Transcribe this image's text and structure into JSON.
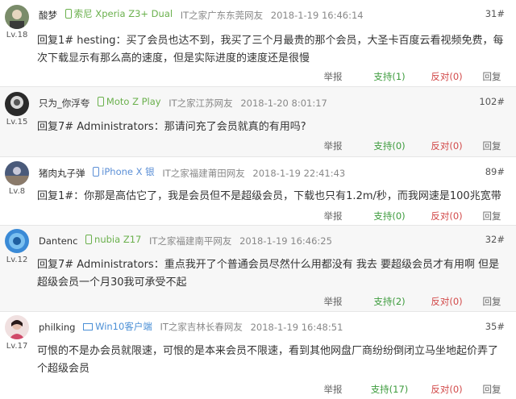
{
  "actions": {
    "report": "举报",
    "reply": "回复"
  },
  "colors": {
    "support": "#3c9b3c",
    "oppose": "#d24a4a",
    "device_green": "#6ab04c",
    "device_blue": "#5b8fd6"
  },
  "comments": [
    {
      "user": "酸梦",
      "device": "索尼 Xperia Z3+ Dual",
      "location": "IT之家广东东莞网友",
      "time": "2018-1-19 16:46:14",
      "floor": "31#",
      "level": "Lv.18",
      "text": "回复1# hesting：买了会员也达不到，我买了三个月最贵的那个会员，大圣卡百度云看视频免费，每次下载显示有那么高的速度，但是实际进度的速度还是很慢",
      "support": "支持(1)",
      "oppose": "反对(0)",
      "device_icon": "phone-icon"
    },
    {
      "user": "只为_你浮夸",
      "device": "Moto Z Play",
      "location": "IT之家江苏网友",
      "time": "2018-1-20 8:01:17",
      "floor": "102#",
      "level": "Lv.15",
      "text": "回复7# Administrators：那请问充了会员就真的有用吗?",
      "support": "支持(0)",
      "oppose": "反对(0)",
      "device_icon": "phone-icon"
    },
    {
      "user": "猪肉丸子弹",
      "device": "iPhone X 银",
      "location": "IT之家福建莆田网友",
      "time": "2018-1-19 22:41:43",
      "floor": "89#",
      "level": "Lv.8",
      "text": "回复1#：你那是高估它了，我是会员但不是超级会员，下载也只有1.2m/秒，而我网速是100兆宽带",
      "support": "支持(0)",
      "oppose": "反对(0)",
      "device_icon": "phone-icon"
    },
    {
      "user": "Dantenc",
      "device": "nubia Z17",
      "location": "IT之家福建南平网友",
      "time": "2018-1-19 16:46:25",
      "floor": "32#",
      "level": "Lv.12",
      "text": "回复7# Administrators：重点我开了个普通会员尽然什么用都没有 我去 要超级会员才有用啊 但是超级会员一个月30我可承受不起",
      "support": "支持(2)",
      "oppose": "反对(0)",
      "device_icon": "phone-icon"
    },
    {
      "user": "philking",
      "device": "Win10客户端",
      "location": "IT之家吉林长春网友",
      "time": "2018-1-19 16:48:51",
      "floor": "35#",
      "level": "Lv.17",
      "text": "可恨的不是办会员就限速，可恨的是本来会员不限速，看到其他网盘厂商纷纷倒闭立马坐地起价弄了个超级会员",
      "support": "支持(17)",
      "oppose": "反对(0)",
      "device_icon": "windows-icon"
    }
  ]
}
